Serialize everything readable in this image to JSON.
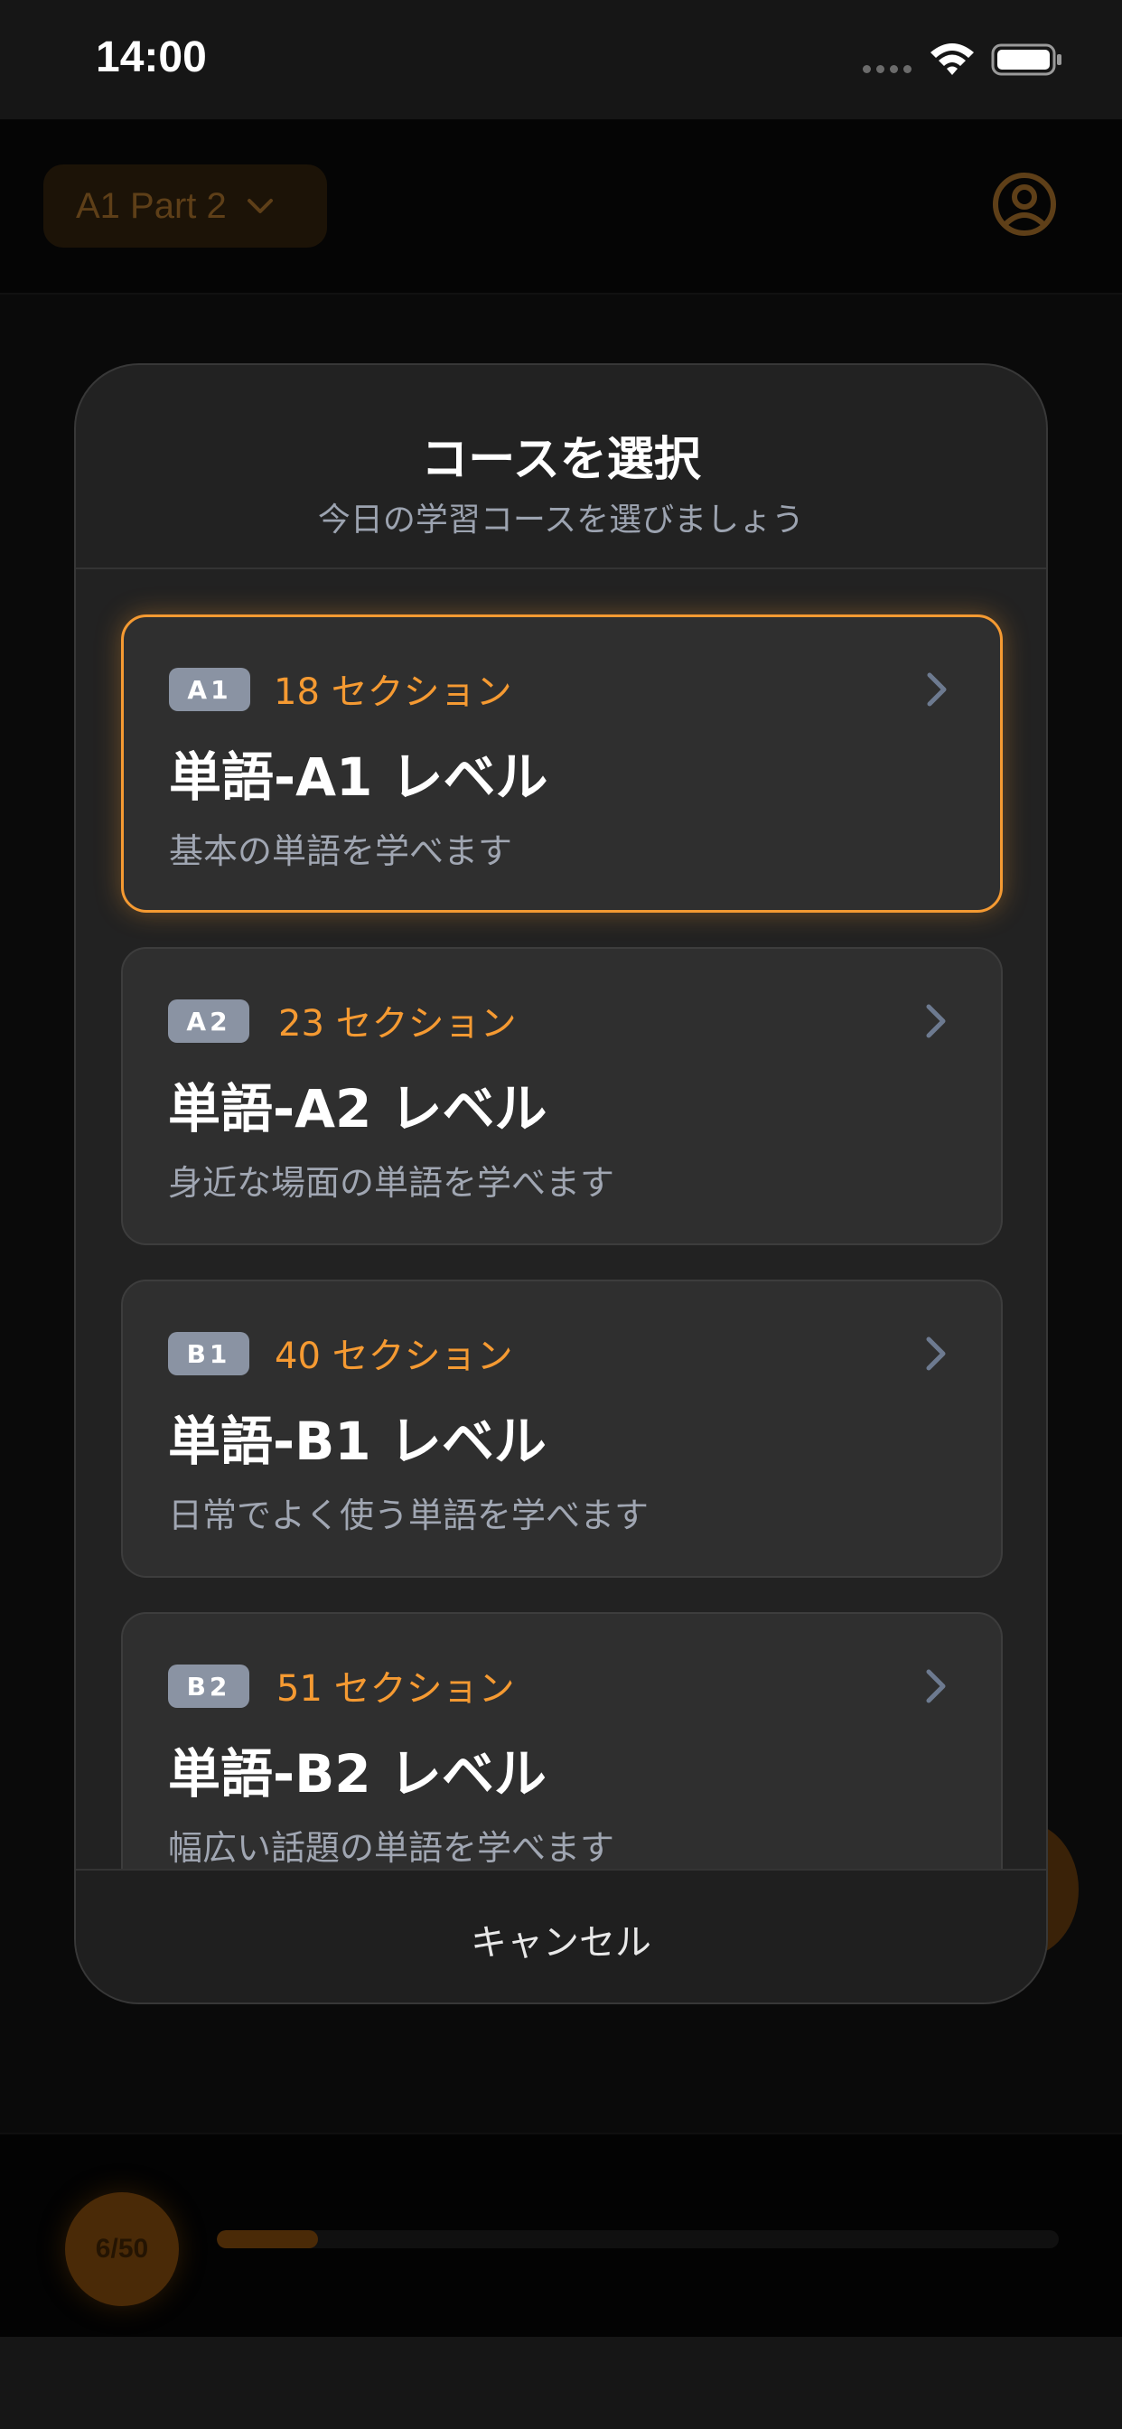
{
  "status_bar": {
    "time": "14:00"
  },
  "background": {
    "course_selector_label": "A1 Part 2",
    "progress_label": "6/50",
    "progress_fraction": 0.12
  },
  "modal": {
    "title": "コースを選択",
    "subtitle": "今日の学習コースを選びましょう",
    "courses": [
      {
        "badge": "A1",
        "sections": "18 セクション",
        "name": "単語-A1 レベル",
        "description": "基本の単語を学べます",
        "selected": true
      },
      {
        "badge": "A2",
        "sections": "23 セクション",
        "name": "単語-A2 レベル",
        "description": "身近な場面の単語を学べます",
        "selected": false
      },
      {
        "badge": "B1",
        "sections": "40 セクション",
        "name": "単語-B1 レベル",
        "description": "日常でよく使う単語を学べます",
        "selected": false
      },
      {
        "badge": "B2",
        "sections": "51 セクション",
        "name": "単語-B2 レベル",
        "description": "幅広い話題の単語を学べます",
        "selected": false
      }
    ],
    "cancel_label": "キャンセル"
  },
  "colors": {
    "accent": "#f59a32",
    "badge": "#8a93a3",
    "card": "#2f2f2f",
    "modal": "#222222"
  }
}
